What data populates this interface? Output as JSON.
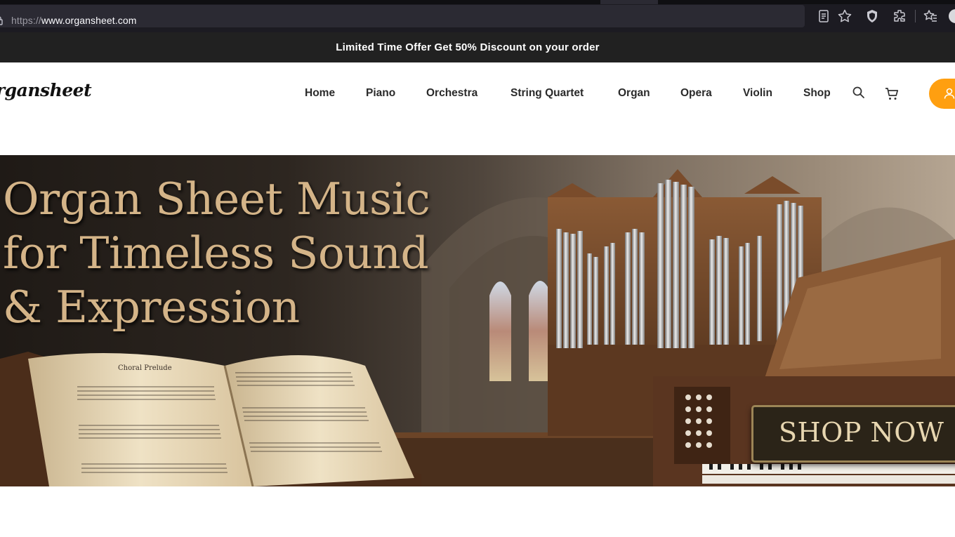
{
  "browser": {
    "url_prefix": "https://",
    "url_host": "www.organsheet.com",
    "icons": [
      "lock-icon",
      "reader-view-icon",
      "bookmark-star-icon",
      "shield-extension-icon",
      "extensions-icon",
      "bookmarks-menu-icon",
      "profile-avatar-icon"
    ]
  },
  "promo": {
    "text": "Limited Time Offer Get 50% Discount on your order"
  },
  "header": {
    "logo": "rgansheet",
    "nav": [
      "Home",
      "Piano",
      "Orchestra",
      "String Quartet",
      "Organ",
      "Opera",
      "Violin",
      "Shop"
    ],
    "icons": [
      "search-icon",
      "cart-icon",
      "user-icon"
    ],
    "accent_color": "#ff9f10"
  },
  "hero": {
    "headline_line1": "Organ Sheet Music",
    "headline_line2": "for Timeless Sound",
    "headline_line3": "& Expression",
    "book_title": "Choral Prelude",
    "cta": "SHOP NOW"
  }
}
